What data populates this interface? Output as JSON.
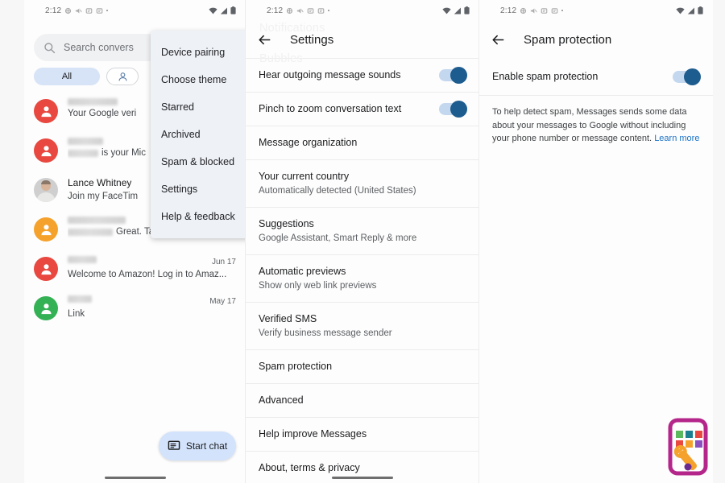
{
  "status_bar": {
    "time": "2:12",
    "left_icons": [
      "app-notification-icon",
      "mute-icon",
      "app-notification-icon",
      "app-notification-icon",
      "dot-icon"
    ],
    "right_icons": [
      "wifi-icon",
      "signal-icon",
      "battery-icon"
    ]
  },
  "panel_conversations": {
    "search": {
      "placeholder": "Search convers",
      "icon": "search-icon"
    },
    "chips": [
      {
        "label": "All",
        "style": "filled"
      },
      {
        "label": "",
        "icon": "person-icon",
        "style": "outlined"
      }
    ],
    "conversations": [
      {
        "name": "",
        "redacted_name": true,
        "name_width": 62,
        "preview": "Your Google veri",
        "preview_redacted_width": 0,
        "date": "",
        "avatar_color": "#e8483f",
        "avatar_type": "person"
      },
      {
        "name": "",
        "redacted_name": true,
        "name_width": 44,
        "preview": "is your Mic",
        "preview_redacted_width": 38,
        "date": "",
        "avatar_color": "#e8483f",
        "avatar_type": "person"
      },
      {
        "name": "Lance Whitney",
        "redacted_name": false,
        "name_width": 0,
        "preview": "Join my FaceTim",
        "preview_redacted_width": 0,
        "date": "",
        "avatar_color": "#cfcfcf",
        "avatar_type": "photo"
      },
      {
        "name": "",
        "redacted_name": true,
        "name_width": 72,
        "preview": "Great. Talk to you then.",
        "preview_redacted_width": 56,
        "date": "",
        "avatar_color": "#f5a22d",
        "avatar_type": "person"
      },
      {
        "name": "",
        "redacted_name": true,
        "name_width": 36,
        "preview": "Welcome to Amazon! Log in to Amaz...",
        "preview_redacted_width": 0,
        "date": "Jun 17",
        "avatar_color": "#e8483f",
        "avatar_type": "person"
      },
      {
        "name": "",
        "redacted_name": true,
        "name_width": 30,
        "preview": "Link",
        "preview_redacted_width": 0,
        "date": "May 17",
        "avatar_color": "#34b155",
        "avatar_type": "person"
      }
    ],
    "overflow_menu": [
      "Device pairing",
      "Choose theme",
      "Starred",
      "Archived",
      "Spam & blocked",
      "Settings",
      "Help & feedback"
    ],
    "fab": {
      "label": "Start chat",
      "icon": "message-icon"
    }
  },
  "panel_settings": {
    "ghost_top": "Notifications",
    "ghost_bottom": "Bubbles",
    "back_icon": "back-arrow-icon",
    "title": "Settings",
    "rows": [
      {
        "title": "Hear outgoing message sounds",
        "sub": "",
        "toggle": true,
        "toggle_on": true
      },
      {
        "title": "Pinch to zoom conversation text",
        "sub": "",
        "toggle": true,
        "toggle_on": true
      },
      {
        "title": "Message organization",
        "sub": "",
        "toggle": false
      },
      {
        "title": "Your current country",
        "sub": "Automatically detected (United States)",
        "toggle": false
      },
      {
        "title": "Suggestions",
        "sub": "Google Assistant, Smart Reply & more",
        "toggle": false
      },
      {
        "title": "Automatic previews",
        "sub": "Show only web link previews",
        "toggle": false
      },
      {
        "title": "Verified SMS",
        "sub": "Verify business message sender",
        "toggle": false
      },
      {
        "title": "Spam protection",
        "sub": "",
        "toggle": false
      },
      {
        "title": "Advanced",
        "sub": "",
        "toggle": false
      },
      {
        "title": "Help improve Messages",
        "sub": "",
        "toggle": false
      },
      {
        "title": "About, terms & privacy",
        "sub": "",
        "toggle": false
      }
    ]
  },
  "panel_spam": {
    "back_icon": "back-arrow-icon",
    "title": "Spam protection",
    "toggle_label": "Enable spam protection",
    "toggle_on": true,
    "note_text": "To help detect spam, Messages sends some data about your messages to Google without including your phone number or message content. ",
    "note_link": "Learn more"
  },
  "watermark": {
    "name": "phone-repair-logo"
  },
  "colors": {
    "accent_blue": "#1d5c8e",
    "track_blue": "#c3d7ef",
    "chip_blue": "#d7e3f7",
    "fab_blue": "#d3e3fb",
    "link_blue": "#1a73c8",
    "page_bg": "#f7f7f7",
    "panel_bg": "#fdfdfd",
    "menu_bg": "#eef1f6"
  }
}
